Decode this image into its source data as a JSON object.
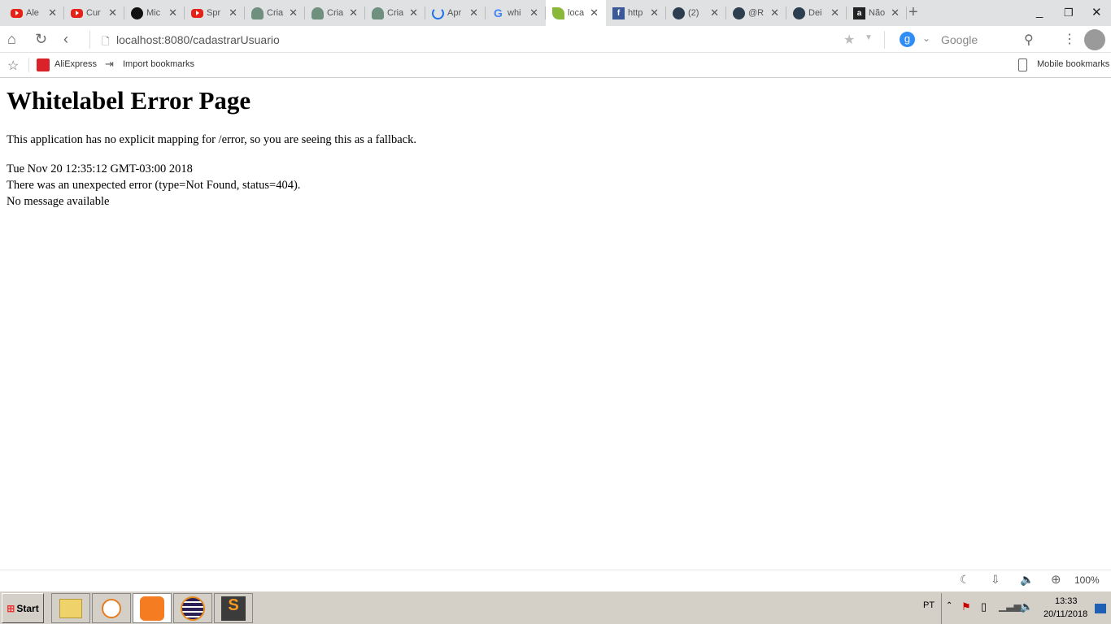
{
  "tabs": [
    {
      "label": "Ale",
      "icon": "youtube-icon"
    },
    {
      "label": "Cur",
      "icon": "youtube-icon"
    },
    {
      "label": "Mic",
      "icon": "github-icon"
    },
    {
      "label": "Spr",
      "icon": "youtube-icon"
    },
    {
      "label": "Cria",
      "icon": "avatar-icon"
    },
    {
      "label": "Cria",
      "icon": "avatar-icon"
    },
    {
      "label": "Cria",
      "icon": "avatar-icon"
    },
    {
      "label": "Apr",
      "icon": "loading-icon"
    },
    {
      "label": "whi",
      "icon": "google-icon"
    },
    {
      "label": "loca",
      "icon": "spring-leaf-icon",
      "active": true
    },
    {
      "label": "http",
      "icon": "facebook-icon"
    },
    {
      "label": "(2)",
      "icon": "circle-icon"
    },
    {
      "label": "@R",
      "icon": "circle-icon"
    },
    {
      "label": "Dei",
      "icon": "circle-icon"
    },
    {
      "label": "Não",
      "icon": "amazon-icon"
    }
  ],
  "close_glyph": "✕",
  "address": {
    "url": "localhost:8080/cadastrarUsuario",
    "search_engine": "Google",
    "search_letter": "g"
  },
  "bookmarks": {
    "items": [
      "AliExpress",
      "Import bookmarks"
    ],
    "mobile": "Mobile bookmarks"
  },
  "page": {
    "title": "Whitelabel Error Page",
    "message": "This application has no explicit mapping for /error, so you are seeing this as a fallback.",
    "timestamp": "Tue Nov 20 12:35:12 GMT-03:00 2018",
    "error": "There was an unexpected error (type=Not Found, status=404).",
    "detail": "No message available"
  },
  "status": {
    "zoom": "100%"
  },
  "taskbar": {
    "start": "Start",
    "lang": "PT",
    "time": "13:33",
    "date": "20/11/2018"
  }
}
